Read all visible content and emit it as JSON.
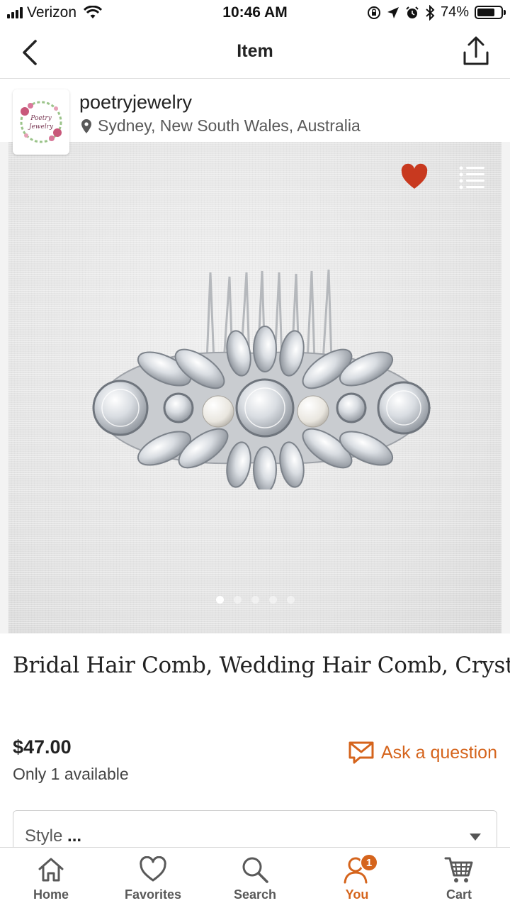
{
  "status_bar": {
    "carrier": "Verizon",
    "time": "10:46 AM",
    "battery_percent_text": "74%",
    "battery_level": 0.74
  },
  "nav": {
    "title": "Item",
    "back_icon": "chevron-left-icon",
    "share_icon": "share-icon"
  },
  "shop": {
    "name": "poetryjewelry",
    "location": "Sydney, New South Wales, Australia",
    "logo_text": "Poetry Jewelry"
  },
  "gallery": {
    "image_count": 5,
    "active_index": 0,
    "favorite_color": "#c8391f"
  },
  "item": {
    "title": "Bridal Hair Comb, Wedding Hair Comb, Crystal",
    "price": "$47.00",
    "availability": "Only 1 available",
    "ask_label": "Ask a question"
  },
  "style_select": {
    "label": "Style",
    "value": "..."
  },
  "tab_bar": {
    "tabs": [
      {
        "label": "Home",
        "icon": "home-icon"
      },
      {
        "label": "Favorites",
        "icon": "heart-icon"
      },
      {
        "label": "Search",
        "icon": "search-icon"
      },
      {
        "label": "You",
        "icon": "user-icon",
        "badge": "1",
        "active": true
      },
      {
        "label": "Cart",
        "icon": "cart-icon"
      }
    ]
  },
  "colors": {
    "accent": "#d5641c",
    "text_primary": "#222222",
    "text_secondary": "#595959"
  }
}
